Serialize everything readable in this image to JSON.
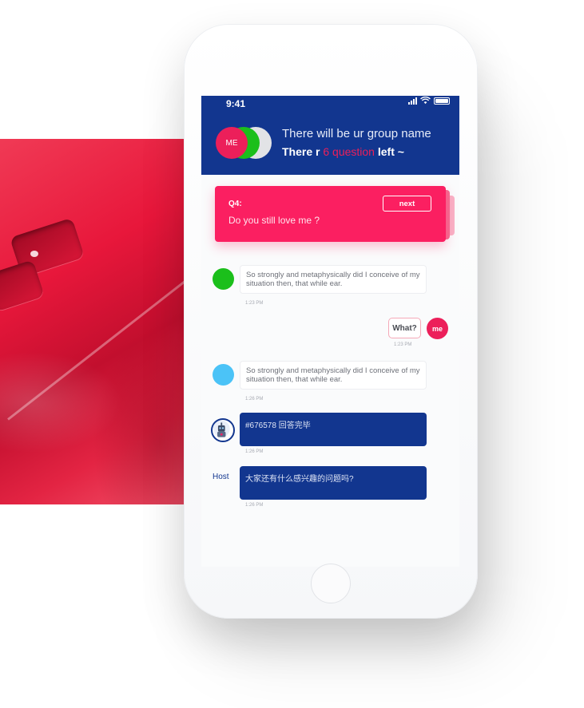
{
  "colors": {
    "header_bg": "#12368f",
    "accent_pink": "#fb1f61",
    "me_pink": "#ec1f5a",
    "green": "#1bbf1b",
    "light_blue": "#4bc3f7",
    "dark_bubble": "#12368f"
  },
  "status_bar": {
    "time": "9:41",
    "icons": [
      "signal-icon",
      "wifi-icon",
      "battery-icon"
    ]
  },
  "header": {
    "avatar_me_label": "ME",
    "group_name": "There will be ur group name",
    "question_prefix": "There r",
    "question_count": "6 question",
    "question_suffix": "left ~"
  },
  "question_card": {
    "label": "Q4:",
    "text": "Do you still love me ?",
    "next_label": "next"
  },
  "messages": [
    {
      "type": "received",
      "avatar": "green-dot",
      "text": "So strongly and metaphysically did I conceive of my situation then, that while ear.",
      "time": "1:23 PM"
    },
    {
      "type": "sent",
      "avatar_label": "me",
      "text": "What?",
      "time": "1:23 PM"
    },
    {
      "type": "received",
      "avatar": "blue-dot",
      "text": "So strongly and metaphysically did I conceive of my situation then, that while ear.",
      "time": "1:26 PM"
    },
    {
      "type": "received-dark",
      "avatar": "robot-icon",
      "text": "#676578 回答完毕",
      "time": "1:26 PM"
    },
    {
      "type": "received-dark",
      "sender_label": "Host",
      "text": "大家还有什么感兴趣的问题吗?",
      "time": "1:26 PM"
    }
  ]
}
